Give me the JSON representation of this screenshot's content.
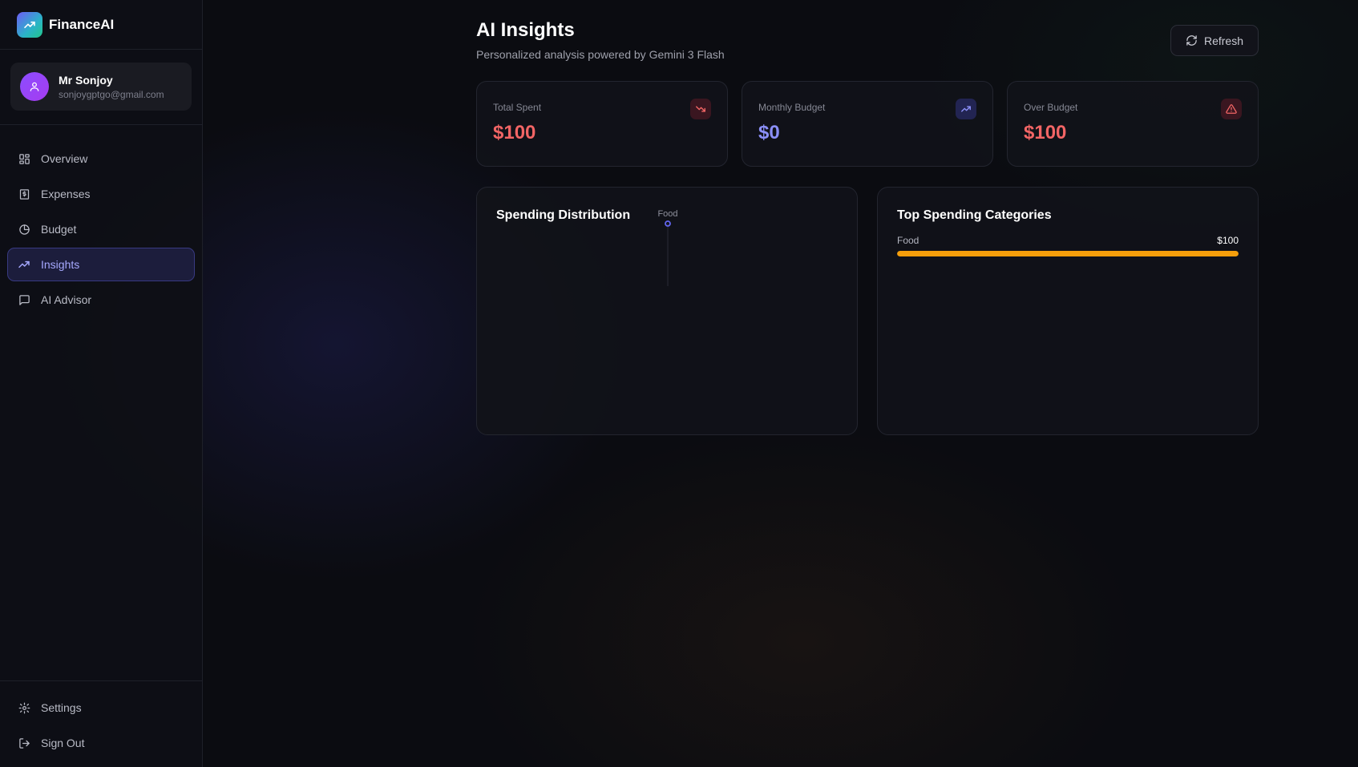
{
  "app": {
    "name": "FinanceAI",
    "logo_icon": "trending-up-icon"
  },
  "user": {
    "name": "Mr Sonjoy",
    "email": "sonjoygptgo@gmail.com"
  },
  "nav": {
    "items": [
      {
        "label": "Overview",
        "icon": "layout-grid-icon",
        "active": false
      },
      {
        "label": "Expenses",
        "icon": "receipt-icon",
        "active": false
      },
      {
        "label": "Budget",
        "icon": "pie-chart-icon",
        "active": false
      },
      {
        "label": "Insights",
        "icon": "trending-up-icon",
        "active": true
      },
      {
        "label": "AI Advisor",
        "icon": "message-square-icon",
        "active": false
      }
    ],
    "bottom": [
      {
        "label": "Settings",
        "icon": "gear-icon"
      },
      {
        "label": "Sign Out",
        "icon": "log-out-icon"
      }
    ]
  },
  "header": {
    "title": "AI Insights",
    "subtitle": "Personalized analysis powered by Gemini 3 Flash",
    "refresh_label": "Refresh"
  },
  "stats": [
    {
      "label": "Total Spent",
      "value": "$100",
      "color": "#f26565",
      "icon": "trending-down-icon"
    },
    {
      "label": "Monthly Budget",
      "value": "$0",
      "color": "#8b8ff8",
      "icon": "trending-up-icon"
    },
    {
      "label": "Over Budget",
      "value": "$100",
      "color": "#f26565",
      "icon": "alert-triangle-icon"
    }
  ],
  "spending_distribution": {
    "title": "Spending Distribution"
  },
  "top_categories": {
    "title": "Top Spending Categories",
    "items": [
      {
        "name": "Food",
        "amount": "$100",
        "share": 1.0,
        "color": "#f59e0b"
      }
    ]
  },
  "chart_data": {
    "type": "radar",
    "title": "Spending Distribution",
    "categories": [
      "Food"
    ],
    "values": [
      100
    ],
    "color": "#6366f1"
  }
}
